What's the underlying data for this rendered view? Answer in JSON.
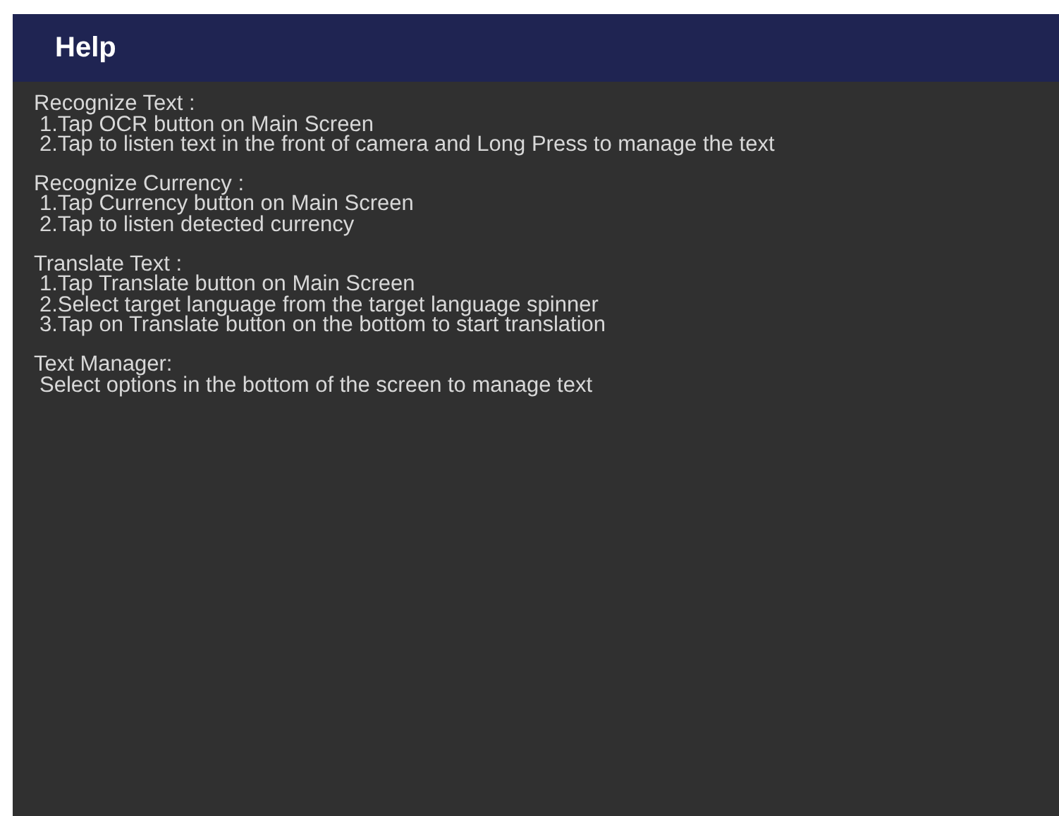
{
  "app_bar": {
    "title": "Help"
  },
  "sections": [
    {
      "title": "Recognize Text :",
      "steps": [
        "1.Tap OCR button on Main Screen",
        "2.Tap to listen text in the front of camera and Long Press to manage the text"
      ]
    },
    {
      "title": "Recognize Currency :",
      "steps": [
        "1.Tap Currency button on Main Screen",
        "2.Tap to listen detected currency"
      ]
    },
    {
      "title": "Translate Text :",
      "steps": [
        "1.Tap Translate button on Main Screen",
        "2.Select target language from the target language spinner",
        "3.Tap on Translate button on the bottom to start translation"
      ]
    },
    {
      "title": "Text Manager:",
      "steps": [
        "Select options in the bottom of the screen to manage text"
      ]
    }
  ]
}
